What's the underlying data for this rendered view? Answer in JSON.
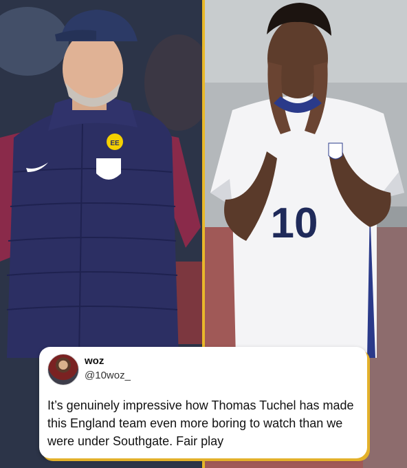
{
  "colors": {
    "divider": "#e8b82a",
    "card_background": "#ffffff",
    "card_shadow": "#e3b12a"
  },
  "left_image": {
    "vest_badge_text": "EE"
  },
  "right_image": {
    "shirt_number": "10"
  },
  "tweet": {
    "author_name": "woz",
    "author_handle": "@10woz_",
    "text": "It’s genuinely impressive how Thomas Tuchel has made this England team even more boring to watch than we were under Southgate. Fair play"
  }
}
